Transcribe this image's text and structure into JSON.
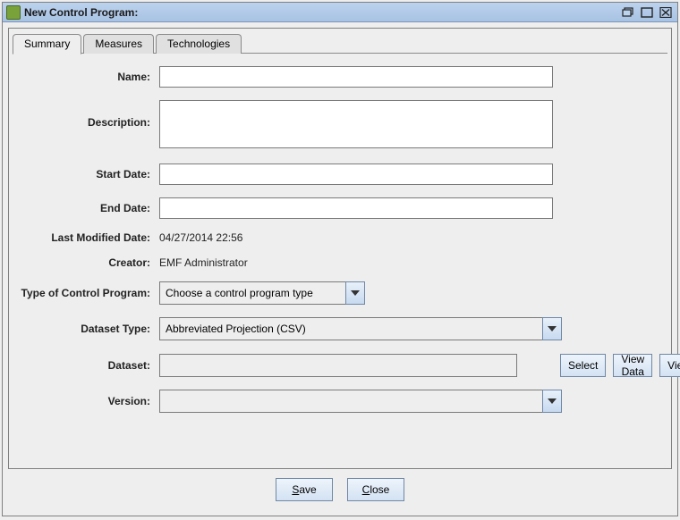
{
  "window": {
    "title": "New Control Program:"
  },
  "tabs": [
    {
      "label": "Summary",
      "active": true
    },
    {
      "label": "Measures",
      "active": false
    },
    {
      "label": "Technologies",
      "active": false
    }
  ],
  "labels": {
    "name": "Name:",
    "description": "Description:",
    "start_date": "Start Date:",
    "end_date": "End Date:",
    "last_modified": "Last Modified Date:",
    "creator": "Creator:",
    "type": "Type of Control Program:",
    "dataset_type": "Dataset Type:",
    "dataset": "Dataset:",
    "version": "Version:"
  },
  "values": {
    "name": "",
    "description": "",
    "start_date": "",
    "end_date": "",
    "last_modified": "04/27/2014 22:56",
    "creator": "EMF Administrator",
    "type_selected": "Choose a control program type",
    "dataset_type_selected": "Abbreviated Projection (CSV)",
    "dataset": "",
    "version_selected": ""
  },
  "buttons": {
    "select": "Select",
    "view_data": "View Data",
    "view": "View",
    "save": "Save",
    "save_mnemonic": "S",
    "close": "Close",
    "close_mnemonic": "C"
  }
}
